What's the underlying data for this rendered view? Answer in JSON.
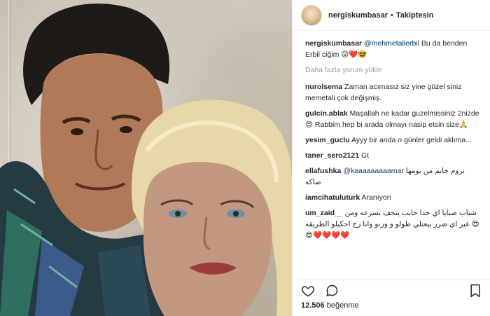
{
  "header": {
    "username": "nergiskumbasar",
    "separator": "•",
    "follow_status": "Takiptesin"
  },
  "caption": {
    "username": "nergiskumbasar",
    "mention": "@mehmetalierbil",
    "text": "Bu da benden Erbil ciğim 😜❤️🤓"
  },
  "load_more": "Daha fazla yorum yükle",
  "comments": [
    {
      "username": "nurolsema",
      "text": "Zaman acımasız siz yine güzel siniz memetali çok değişmiş."
    },
    {
      "username": "gulcin.ablak",
      "text": "Maşallah ne kadar guzelmissiniz 2nizde😍 Rabbim hep bi arada olmayı nasip etsin size🙏"
    },
    {
      "username": "yesim_guclu",
      "text": "Ayyy bir anda o günler geldi aklıma..."
    },
    {
      "username": "taner_sero2121",
      "text": "Gt"
    },
    {
      "username": "ellafushka",
      "mention": "@kaaaaaaaaamar",
      "text": "نروم خانم من يومها صاكه"
    },
    {
      "username": "iamcihatuluturk",
      "text": "Aranıyon"
    },
    {
      "username": "um_zaid__",
      "text": "شباب صبايا اي حدا حابب ينحف بسرعه ومن غير اي ضرر بيعتلي طولو و وزنو وانا رح احكيلو الطريقه 😍😍❤️❤️❤️❤️"
    }
  ],
  "actions": {
    "like_icon": "heart-icon",
    "comment_icon": "comment-icon",
    "save_icon": "bookmark-icon"
  },
  "likes": {
    "count": "12.506",
    "label": "beğenme"
  }
}
